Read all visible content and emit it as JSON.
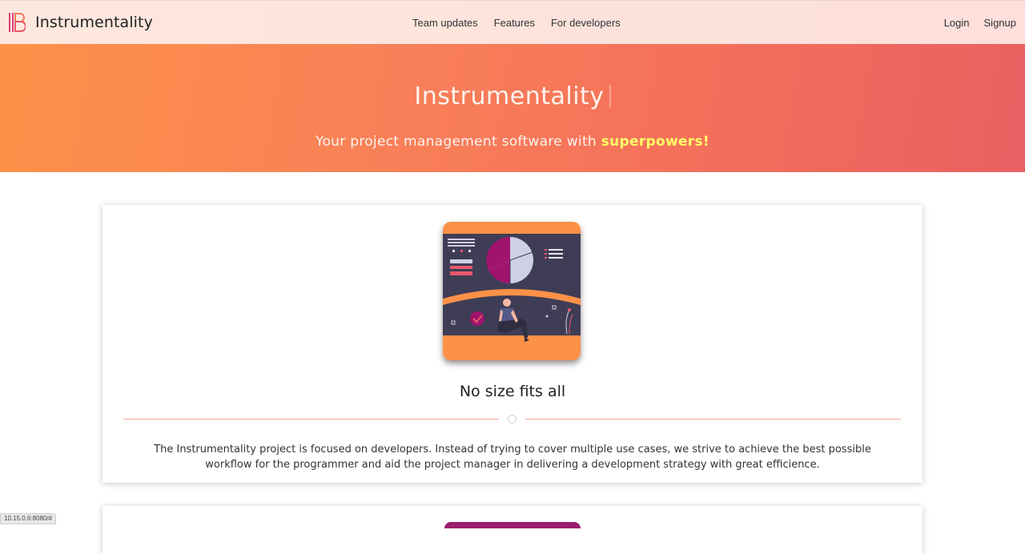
{
  "navbar": {
    "brand": "Instrumentality",
    "links": [
      "Team updates",
      "Features",
      "For developers"
    ],
    "login": "Login",
    "signup": "Signup"
  },
  "hero": {
    "title": "Instrumentality",
    "subtitle_prefix": "Your project management software with ",
    "subtitle_highlight": "superpowers!"
  },
  "card": {
    "title": "No size fits all",
    "text": "The Instrumentality project is focused on developers. Instead of trying to cover multiple use cases, we strive to achieve the best possible workflow for the programmer and aid the project manager in delivering a development strategy with great efficience."
  },
  "status_bar": "10.15.0.6:8080/#",
  "colors": {
    "hero_start": "#fe9148",
    "hero_end": "#ea5f62",
    "highlight": "#ffff66",
    "illustration_bg": "#3f3d56",
    "illustration_accent": "#fe9148",
    "illustration_magenta": "#a0146e"
  }
}
